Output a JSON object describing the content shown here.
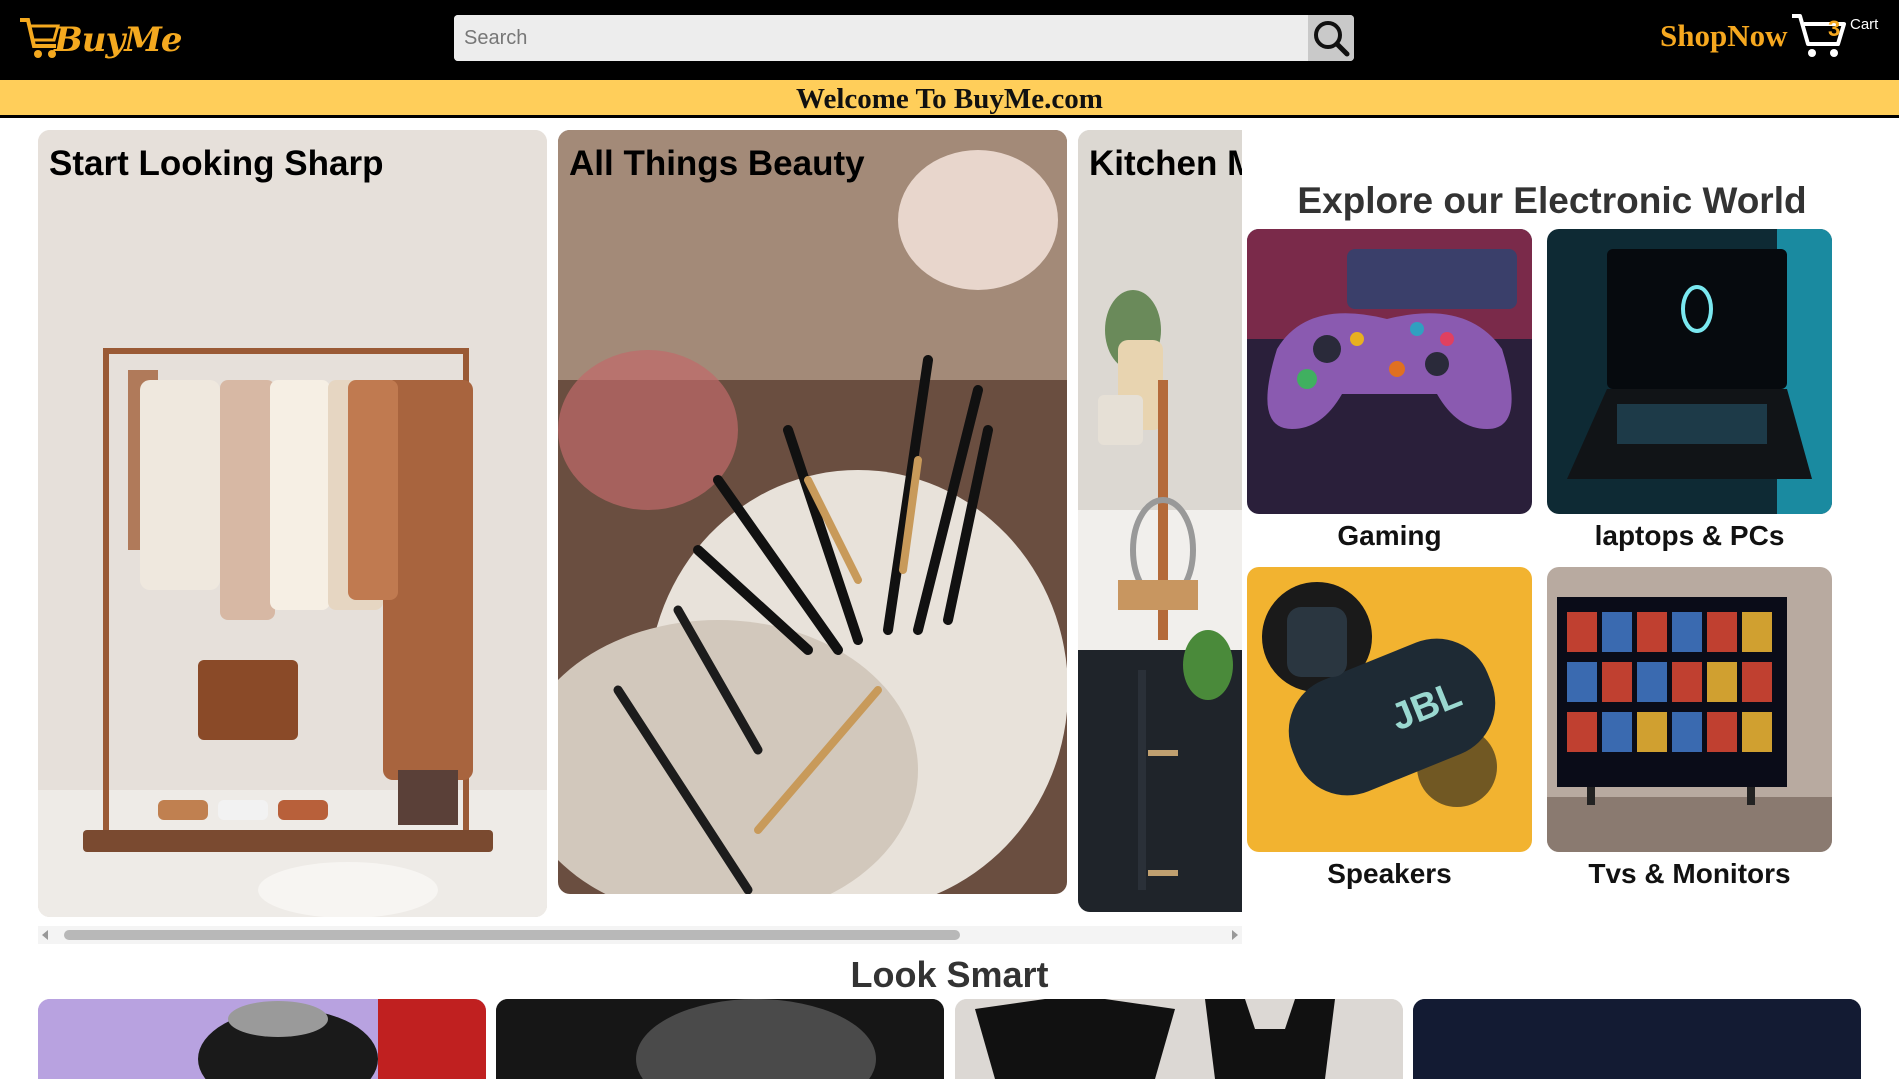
{
  "header": {
    "logo_text": "BuyMe",
    "search_placeholder": "Search",
    "shop_now": "ShopNow",
    "cart_count": "3",
    "cart_label": "Cart"
  },
  "banner": {
    "text": "Welcome To BuyMe.com"
  },
  "carousel": {
    "cards": [
      {
        "title": "Start Looking Sharp"
      },
      {
        "title": "All Things Beauty"
      },
      {
        "title": "Kitchen M"
      }
    ]
  },
  "electronics": {
    "title": "Explore our Electronic World",
    "tiles": [
      {
        "label": "Gaming"
      },
      {
        "label": "laptops & PCs"
      },
      {
        "label": "Speakers"
      },
      {
        "label": "Tvs & Monitors"
      }
    ],
    "speaker_brand": "JBL"
  },
  "look_smart": {
    "title": "Look Smart"
  },
  "colors": {
    "accent": "#f6a81f",
    "banner": "#ffce5a",
    "header": "#000000"
  }
}
